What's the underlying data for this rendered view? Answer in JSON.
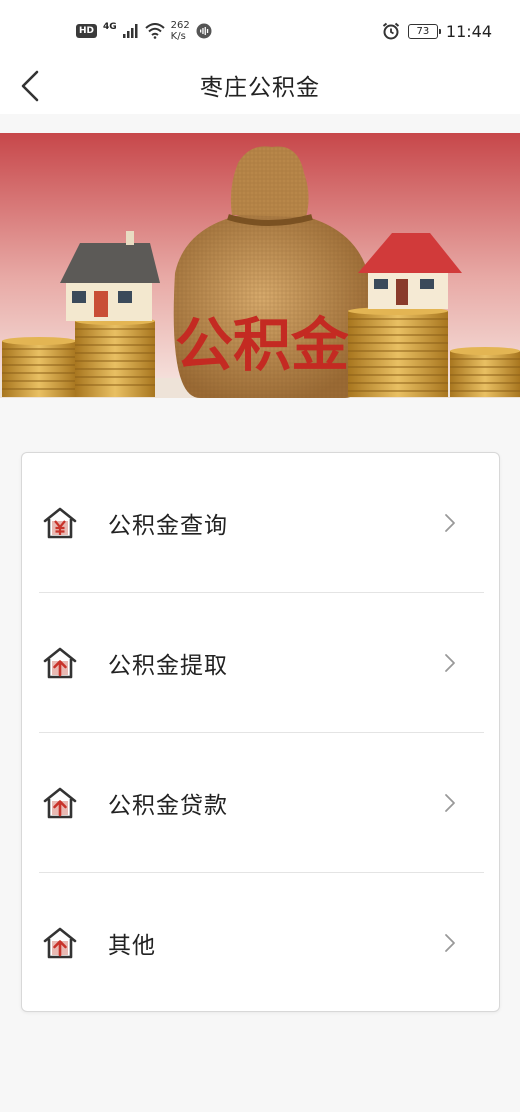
{
  "status_bar": {
    "hd": "HD",
    "network": "4G",
    "speed_value": "262",
    "speed_unit": "K/s",
    "battery": "73",
    "time": "11:44"
  },
  "header": {
    "title": "枣庄公积金"
  },
  "banner": {
    "bag_text": "公积金"
  },
  "menu": {
    "items": [
      {
        "label": "公积金查询",
        "icon": "house-yuan-icon"
      },
      {
        "label": "公积金提取",
        "icon": "house-arrow-up-icon"
      },
      {
        "label": "公积金贷款",
        "icon": "house-arrow-up-icon"
      },
      {
        "label": "其他",
        "icon": "house-arrow-up-icon"
      }
    ]
  },
  "colors": {
    "accent_red": "#c8332a",
    "icon_dark": "#333333"
  }
}
